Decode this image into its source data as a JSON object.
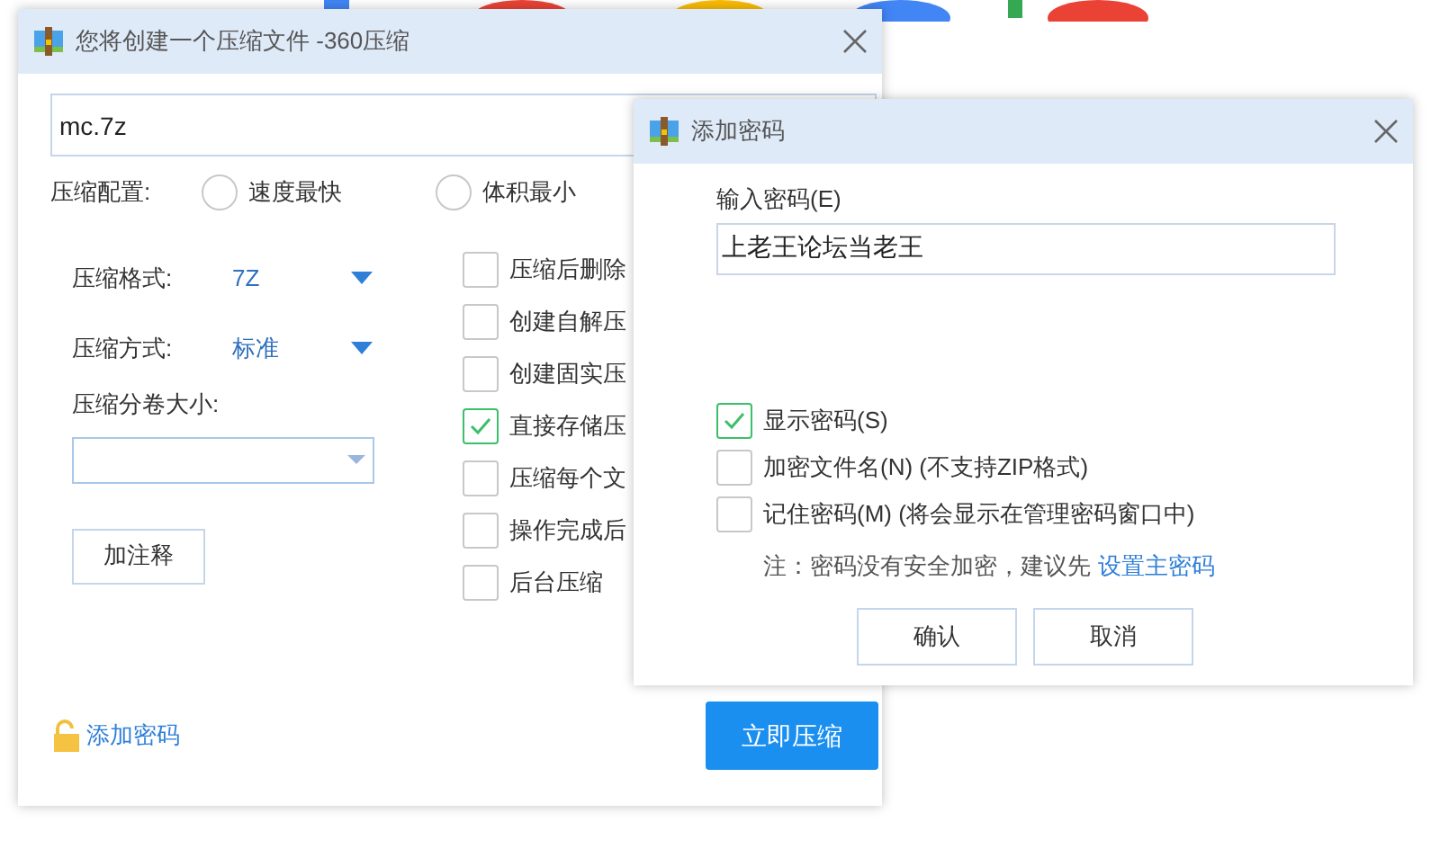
{
  "main_window": {
    "title": "您将创建一个压缩文件 -360压缩",
    "filename": "mc.7z",
    "config_label": "压缩配置:",
    "config_options": [
      {
        "label": "速度最快",
        "selected": false
      },
      {
        "label": "体积最小",
        "selected": false
      }
    ],
    "format": {
      "label": "压缩格式:",
      "value": "7Z"
    },
    "method": {
      "label": "压缩方式:",
      "value": "标准"
    },
    "split": {
      "label": "压缩分卷大小:"
    },
    "comment_button": "加注释",
    "options": [
      {
        "label": "压缩后删除",
        "checked": false
      },
      {
        "label": "创建自解压",
        "checked": false
      },
      {
        "label": "创建固实压",
        "checked": false
      },
      {
        "label": "直接存储压",
        "checked": true
      },
      {
        "label": "压缩每个文",
        "checked": false
      },
      {
        "label": "操作完成后",
        "checked": false
      },
      {
        "label": "后台压缩",
        "checked": false
      }
    ],
    "add_password_link": "添加密码",
    "compress_button": "立即压缩"
  },
  "password_dialog": {
    "title": "添加密码",
    "field_label": "输入密码(E)",
    "password": "上老王论坛当老王",
    "options": [
      {
        "label": "显示密码(S)",
        "checked": true
      },
      {
        "label": "加密文件名(N) (不支持ZIP格式)",
        "checked": false
      },
      {
        "label": "记住密码(M) (将会显示在管理密码窗口中)",
        "checked": false
      }
    ],
    "note": "注：密码没有安全加密，建议先",
    "note_link": "设置主密码",
    "buttons": [
      "确认",
      "取消"
    ]
  }
}
